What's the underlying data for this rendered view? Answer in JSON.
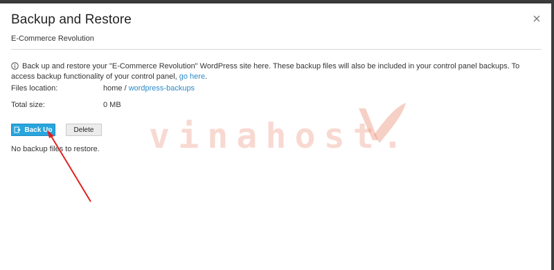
{
  "dialog": {
    "title": "Backup and Restore",
    "subtitle": "E-Commerce Revolution",
    "close_icon": "close-icon"
  },
  "info": {
    "icon": "info-icon",
    "text": "Back up and restore your \"E-Commerce Revolution\" WordPress site here. These backup files will also be included in your control panel backups. To access backup functionality of your control panel, ",
    "link_text": "go here",
    "trailing": "."
  },
  "details": {
    "files_location_label": "Files location:",
    "files_location_prefix": "home / ",
    "files_location_link": "wordpress-backups",
    "total_size_label": "Total size:",
    "total_size_value": "0 MB"
  },
  "buttons": {
    "backup_label": "Back Up",
    "delete_label": "Delete"
  },
  "empty_message": "No backup files to restore.",
  "watermark": {
    "text": "vinahost.",
    "color": "#e6785a"
  },
  "colors": {
    "accent": "#28a5dd",
    "link": "#2a8ac8",
    "annotation_arrow": "#e02020"
  }
}
